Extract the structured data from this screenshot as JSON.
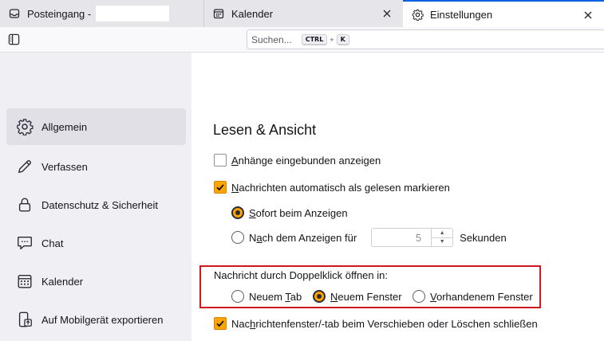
{
  "tabs": [
    {
      "label": "Posteingang -",
      "icon": "inbox-icon"
    },
    {
      "label": "Kalender",
      "icon": "calendar-icon",
      "close": "×"
    },
    {
      "label": "Einstellungen",
      "icon": "gear-icon",
      "close": "×"
    }
  ],
  "search": {
    "placeholder": "Suchen...",
    "shortcut_ctrl": "CTRL",
    "shortcut_plus": "+",
    "shortcut_key": "K"
  },
  "sidebar": {
    "items": [
      {
        "label": "Allgemein",
        "icon": "gear-icon",
        "active": true
      },
      {
        "label": "Verfassen",
        "icon": "pencil-icon"
      },
      {
        "label": "Datenschutz & Sicherheit",
        "icon": "lock-icon"
      },
      {
        "label": "Chat",
        "icon": "chat-icon"
      },
      {
        "label": "Kalender",
        "icon": "calendar-icon"
      },
      {
        "label": "Auf Mobilgerät exportieren",
        "icon": "mobile-export-icon"
      }
    ]
  },
  "section": {
    "title": "Lesen & Ansicht",
    "show_attachments_inline": {
      "underline": "A",
      "rest": "nhänge eingebunden anzeigen",
      "checked": false
    },
    "auto_mark_read": {
      "underline": "N",
      "rest": "achrichten automatisch als gelesen markieren",
      "checked": true
    },
    "immediately": {
      "underline": "S",
      "rest": "ofort beim Anzeigen",
      "checked": true
    },
    "after_display": {
      "pre": "N",
      "underline": "a",
      "rest": "ch dem Anzeigen für",
      "checked": false
    },
    "seconds_value": "5",
    "seconds_label": "Sekunden",
    "doubleclick_label": "Nachricht durch Doppelklick öffnen in:",
    "open_new_tab": {
      "pre": "Neuem ",
      "underline": "T",
      "rest": "ab",
      "checked": false
    },
    "open_new_window": {
      "underline": "N",
      "rest": "euem Fenster",
      "checked": true
    },
    "open_existing_window": {
      "underline": "V",
      "rest": "orhandenem Fenster",
      "checked": false
    },
    "close_on_move": {
      "pre": "Nac",
      "underline": "h",
      "rest": "richtenfenster/-tab beim Verschieben oder Löschen schließen",
      "checked": true
    }
  },
  "colors": {
    "accent": "#ffa500",
    "highlight": "#d0161e",
    "tab_active": "#0061e0"
  }
}
